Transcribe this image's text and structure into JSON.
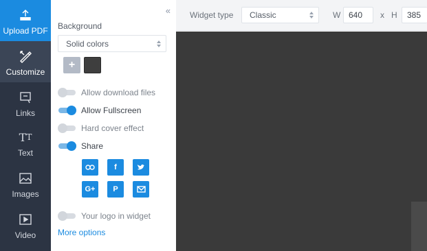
{
  "nav": {
    "items": [
      {
        "label": "Upload PDF",
        "icon": "upload-icon"
      },
      {
        "label": "Customize",
        "icon": "customize-icon"
      },
      {
        "label": "Links",
        "icon": "links-icon"
      },
      {
        "label": "Text",
        "icon": "text-icon"
      },
      {
        "label": "Images",
        "icon": "images-icon"
      },
      {
        "label": "Video",
        "icon": "video-icon"
      }
    ]
  },
  "panel": {
    "collapse_icon": "«",
    "background_label": "Background",
    "background_select": "Solid colors",
    "add_color": "+",
    "swatch_color": "#3e3e3e",
    "toggles": [
      {
        "label": "Allow download files",
        "on": false
      },
      {
        "label": "Allow Fullscreen",
        "on": true
      },
      {
        "label": "Hard cover effect",
        "on": false
      },
      {
        "label": "Share",
        "on": true
      },
      {
        "label": "Your logo in widget",
        "on": false
      }
    ],
    "share_buttons": [
      {
        "icon": "link-icon"
      },
      {
        "icon": "facebook-icon",
        "text": "f"
      },
      {
        "icon": "twitter-icon"
      },
      {
        "icon": "google-plus-icon",
        "text": "G+"
      },
      {
        "icon": "pinterest-icon",
        "text": "P"
      },
      {
        "icon": "email-icon"
      }
    ],
    "more_options": "More options"
  },
  "topbar": {
    "widget_type_label": "Widget type",
    "widget_type_value": "Classic",
    "width_label": "W",
    "width_value": "640",
    "times_label": "x",
    "height_label": "H",
    "height_value": "385"
  },
  "colors": {
    "accent": "#1b8be0",
    "nav_bg": "#2c3443",
    "preview_bg": "#3a3a3a"
  }
}
